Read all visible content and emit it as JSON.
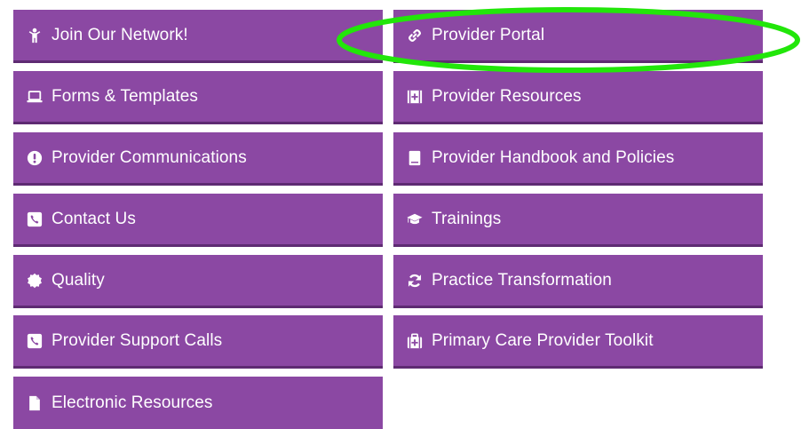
{
  "left_column": [
    {
      "label": "Join Our Network!",
      "icon": "person-icon"
    },
    {
      "label": "Forms & Templates",
      "icon": "laptop-icon"
    },
    {
      "label": "Provider Communications",
      "icon": "alert-circle-icon"
    },
    {
      "label": "Contact Us",
      "icon": "phone-square-icon"
    },
    {
      "label": "Quality",
      "icon": "badge-icon"
    },
    {
      "label": "Provider Support Calls",
      "icon": "phone-square-icon"
    },
    {
      "label": "Electronic Resources",
      "icon": "file-icon"
    }
  ],
  "right_column": [
    {
      "label": "Provider Portal",
      "icon": "link-icon"
    },
    {
      "label": "Provider Resources",
      "icon": "medkit-square-icon"
    },
    {
      "label": "Provider Handbook and Policies",
      "icon": "book-icon"
    },
    {
      "label": "Trainings",
      "icon": "graduation-cap-icon"
    },
    {
      "label": "Practice Transformation",
      "icon": "refresh-icon"
    },
    {
      "label": "Primary Care Provider Toolkit",
      "icon": "medkit-icon"
    }
  ],
  "colors": {
    "tile_background": "#8b48a3",
    "tile_border": "#5e2b72",
    "tile_text": "#ffffff",
    "highlight_outline": "#22e60a"
  }
}
